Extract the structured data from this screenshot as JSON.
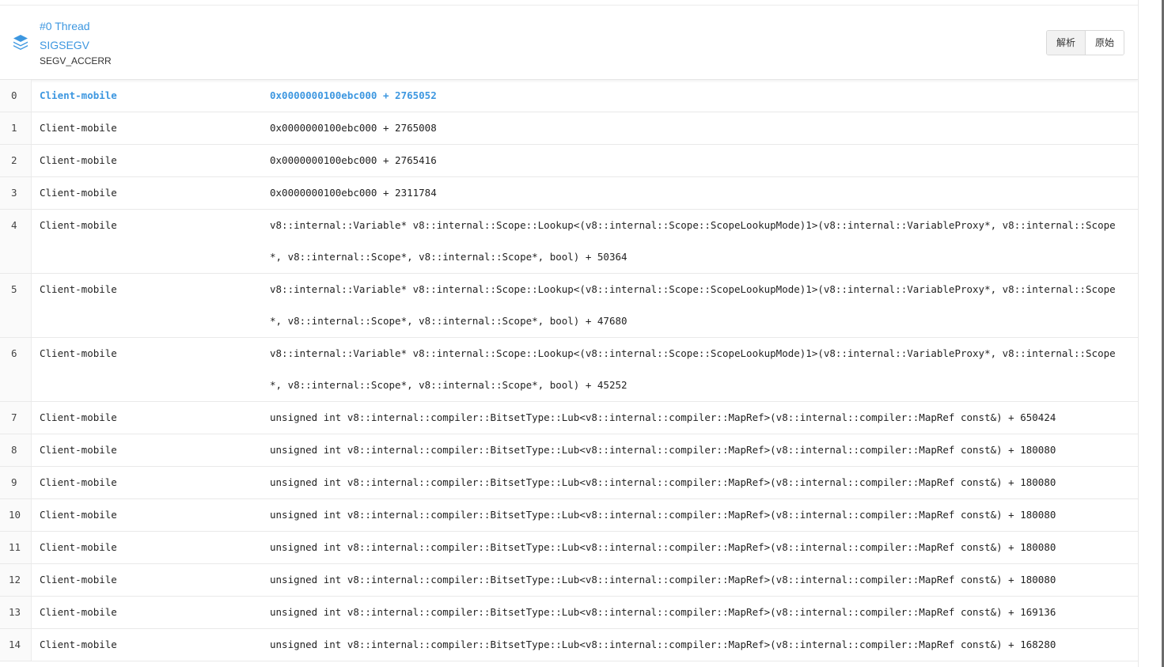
{
  "header": {
    "thread_title": "#0 Thread",
    "signal": "SIGSEGV",
    "code": "SEGV_ACCERR",
    "buttons": {
      "parsed": "解析",
      "raw": "原始"
    }
  },
  "colors": {
    "accent": "#3d97e0",
    "row_border": "#e9e9e9",
    "index_bg": "#fafafa"
  },
  "frames": [
    {
      "index": "0",
      "module": "Client-mobile",
      "address": "0x0000000100ebc000 + 2765052"
    },
    {
      "index": "1",
      "module": "Client-mobile",
      "address": "0x0000000100ebc000 + 2765008"
    },
    {
      "index": "2",
      "module": "Client-mobile",
      "address": "0x0000000100ebc000 + 2765416"
    },
    {
      "index": "3",
      "module": "Client-mobile",
      "address": "0x0000000100ebc000 + 2311784"
    },
    {
      "index": "4",
      "module": "Client-mobile",
      "address": "v8::internal::Variable* v8::internal::Scope::Lookup<(v8::internal::Scope::ScopeLookupMode)1>(v8::internal::VariableProxy*, v8::internal::Scope*, v8::internal::Scope*, v8::internal::Scope*, bool) + 50364"
    },
    {
      "index": "5",
      "module": "Client-mobile",
      "address": "v8::internal::Variable* v8::internal::Scope::Lookup<(v8::internal::Scope::ScopeLookupMode)1>(v8::internal::VariableProxy*, v8::internal::Scope*, v8::internal::Scope*, v8::internal::Scope*, bool) + 47680"
    },
    {
      "index": "6",
      "module": "Client-mobile",
      "address": "v8::internal::Variable* v8::internal::Scope::Lookup<(v8::internal::Scope::ScopeLookupMode)1>(v8::internal::VariableProxy*, v8::internal::Scope*, v8::internal::Scope*, v8::internal::Scope*, bool) + 45252"
    },
    {
      "index": "7",
      "module": "Client-mobile",
      "address": "unsigned int v8::internal::compiler::BitsetType::Lub<v8::internal::compiler::MapRef>(v8::internal::compiler::MapRef const&) + 650424"
    },
    {
      "index": "8",
      "module": "Client-mobile",
      "address": "unsigned int v8::internal::compiler::BitsetType::Lub<v8::internal::compiler::MapRef>(v8::internal::compiler::MapRef const&) + 180080"
    },
    {
      "index": "9",
      "module": "Client-mobile",
      "address": "unsigned int v8::internal::compiler::BitsetType::Lub<v8::internal::compiler::MapRef>(v8::internal::compiler::MapRef const&) + 180080"
    },
    {
      "index": "10",
      "module": "Client-mobile",
      "address": "unsigned int v8::internal::compiler::BitsetType::Lub<v8::internal::compiler::MapRef>(v8::internal::compiler::MapRef const&) + 180080"
    },
    {
      "index": "11",
      "module": "Client-mobile",
      "address": "unsigned int v8::internal::compiler::BitsetType::Lub<v8::internal::compiler::MapRef>(v8::internal::compiler::MapRef const&) + 180080"
    },
    {
      "index": "12",
      "module": "Client-mobile",
      "address": "unsigned int v8::internal::compiler::BitsetType::Lub<v8::internal::compiler::MapRef>(v8::internal::compiler::MapRef const&) + 180080"
    },
    {
      "index": "13",
      "module": "Client-mobile",
      "address": "unsigned int v8::internal::compiler::BitsetType::Lub<v8::internal::compiler::MapRef>(v8::internal::compiler::MapRef const&) + 169136"
    },
    {
      "index": "14",
      "module": "Client-mobile",
      "address": "unsigned int v8::internal::compiler::BitsetType::Lub<v8::internal::compiler::MapRef>(v8::internal::compiler::MapRef const&) + 168280"
    }
  ]
}
